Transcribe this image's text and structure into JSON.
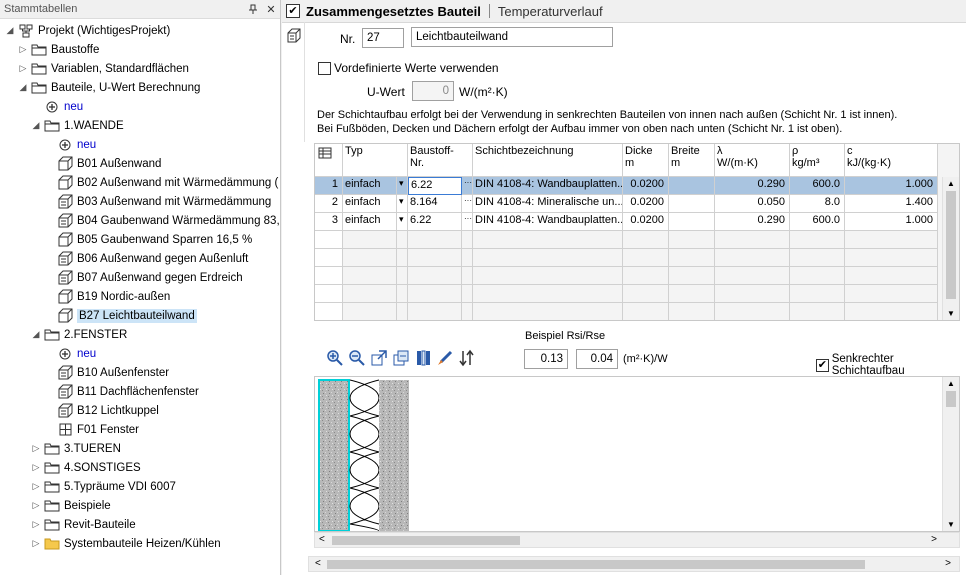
{
  "left": {
    "title": "Stammtabellen",
    "pin_icon": "pin-icon",
    "close_icon": "close-icon",
    "tree": [
      {
        "label": "Projekt (WichtigesProjekt)",
        "icon": "project-icon",
        "exp": "◢"
      },
      {
        "label": "Baustoffe",
        "icon": "folder-icon",
        "exp": "▷"
      },
      {
        "label": "Variablen, Standardflächen",
        "icon": "folder-icon",
        "exp": "▷"
      },
      {
        "label": "Bauteile, U-Wert Berechnung",
        "icon": "folder-icon",
        "exp": "◢"
      },
      {
        "label": "neu",
        "icon": "plus-icon",
        "exp": ""
      },
      {
        "label": "1.WAENDE",
        "icon": "folder-icon",
        "exp": "◢"
      },
      {
        "label": "neu",
        "icon": "plus-icon",
        "exp": ""
      },
      {
        "label": "B01 Außenwand",
        "icon": "cube-icon",
        "exp": ""
      },
      {
        "label": "B02 Außenwand mit Wärmedämmung (",
        "icon": "cube-icon",
        "exp": ""
      },
      {
        "label": "B03 Außenwand mit Wärmedämmung",
        "icon": "cube-layers-icon",
        "exp": ""
      },
      {
        "label": "B04 Gaubenwand Wärmedämmung 83,",
        "icon": "cube-layers-icon",
        "exp": ""
      },
      {
        "label": "B05 Gaubenwand Sparren 16,5 %",
        "icon": "cube-icon",
        "exp": ""
      },
      {
        "label": "B06 Außenwand gegen Außenluft",
        "icon": "cube-layers-icon",
        "exp": ""
      },
      {
        "label": "B07 Außenwand gegen Erdreich",
        "icon": "cube-layers-icon",
        "exp": ""
      },
      {
        "label": "B19 Nordic-außen",
        "icon": "cube-icon",
        "exp": ""
      },
      {
        "label": "B27 Leichtbauteilwand",
        "icon": "cube-icon",
        "exp": "",
        "selected": true
      },
      {
        "label": "2.FENSTER",
        "icon": "folder-icon",
        "exp": "◢"
      },
      {
        "label": "neu",
        "icon": "plus-icon",
        "exp": ""
      },
      {
        "label": "B10 Außenfenster",
        "icon": "cube-layers-icon",
        "exp": ""
      },
      {
        "label": "B11 Dachflächenfenster",
        "icon": "cube-layers-icon",
        "exp": ""
      },
      {
        "label": "B12 Lichtkuppel",
        "icon": "cube-layers-icon",
        "exp": ""
      },
      {
        "label": "F01 Fenster",
        "icon": "window-icon",
        "exp": ""
      },
      {
        "label": "3.TUEREN",
        "icon": "folder-icon",
        "exp": "▷"
      },
      {
        "label": "4.SONSTIGES",
        "icon": "folder-icon",
        "exp": "▷"
      },
      {
        "label": "5.Typräume VDI 6007",
        "icon": "folder-icon",
        "exp": "▷"
      },
      {
        "label": "Beispiele",
        "icon": "folder-icon",
        "exp": "▷"
      },
      {
        "label": "Revit-Bauteile",
        "icon": "folder-icon",
        "exp": "▷"
      },
      {
        "label": "Systembauteile Heizen/Kühlen",
        "icon": "folder-yellow-icon",
        "exp": "▷"
      }
    ]
  },
  "tabs": {
    "active": "Zusammengesetztes Bauteil",
    "other": "Temperaturverlauf"
  },
  "form": {
    "nr_label": "Nr.",
    "nr_value": "27",
    "name_value": "Leichtbauteilwand",
    "predefined_label": "Vordefinierte Werte verwenden",
    "uwert_label": "U-Wert",
    "uwert_value": "0",
    "uwert_unit": "W/(m²·K)",
    "info_line1": "Der Schichtaufbau erfolgt bei der Verwendung in senkrechten Bauteilen von innen nach außen (Schicht Nr. 1 ist innen).",
    "info_line2": "Bei Fußböden, Decken und Dächern erfolgt der Aufbau immer von oben nach unten (Schicht Nr. 1 ist oben)."
  },
  "grid": {
    "headers": [
      "Typ",
      "Baustoff-\nNr.",
      "Schichtbezeichnung",
      "Dicke\nm",
      "Breite\nm",
      "λ\nW/(m·K)",
      "ρ\nkg/m³",
      "c\nkJ/(kg·K)"
    ],
    "rows": [
      {
        "n": "1",
        "typ": "einfach",
        "nr": "6.22",
        "bez": "DIN 4108-4: Wandbauplatten...",
        "dicke": "0.0200",
        "breite": "",
        "lambda": "0.290",
        "rho": "600.0",
        "c": "1.000"
      },
      {
        "n": "2",
        "typ": "einfach",
        "nr": "8.164",
        "bez": "DIN 4108-4: Mineralische un...",
        "dicke": "0.0200",
        "breite": "",
        "lambda": "0.050",
        "rho": "8.0",
        "c": "1.400"
      },
      {
        "n": "3",
        "typ": "einfach",
        "nr": "6.22",
        "bez": "DIN 4108-4: Wandbauplatten...",
        "dicke": "0.0200",
        "breite": "",
        "lambda": "0.290",
        "rho": "600.0",
        "c": "1.000"
      }
    ]
  },
  "rsi": {
    "label": "Beispiel Rsi/Rse",
    "rsi_value": "0.13",
    "rse_value": "0.04",
    "unit": "(m²·K)/W",
    "vertical_label": "Senkrechter Schichtaufbau"
  },
  "toolbar_icons": [
    "zoom-in-icon",
    "zoom-out-icon",
    "export-icon",
    "import-icon",
    "layers-icon",
    "brush-icon",
    "sort-icon"
  ]
}
